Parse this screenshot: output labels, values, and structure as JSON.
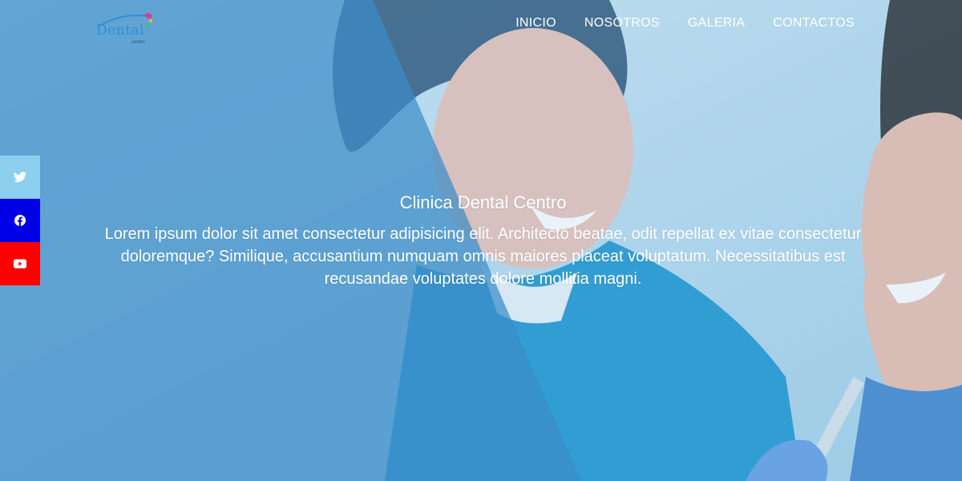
{
  "brand": {
    "logo_text": "Dental",
    "logo_sub": "centro",
    "accent_color": "#2f8fd6"
  },
  "nav": {
    "items": [
      {
        "label": "INICIO"
      },
      {
        "label": "NOSOTROS"
      },
      {
        "label": "GALERIA"
      },
      {
        "label": "CONTACTOS"
      }
    ]
  },
  "social": [
    {
      "name": "twitter",
      "icon": "twitter-icon",
      "color": "#8ecff0"
    },
    {
      "name": "facebook",
      "icon": "facebook-icon",
      "color": "#0000e6"
    },
    {
      "name": "youtube",
      "icon": "youtube-icon",
      "color": "#ff0000"
    }
  ],
  "hero": {
    "title": "Clinica Dental Centro",
    "description": "Lorem ipsum dolor sit amet consectetur adipisicing elit. Architecto beatae, odit repellat ex vitae consectetur doloremque? Similique, accusantium numquam omnis maiores placeat voluptatum. Necessitatibus est recusandae voluptates dolore mollitia magni.",
    "overlay_color": "#3c8cc8"
  }
}
